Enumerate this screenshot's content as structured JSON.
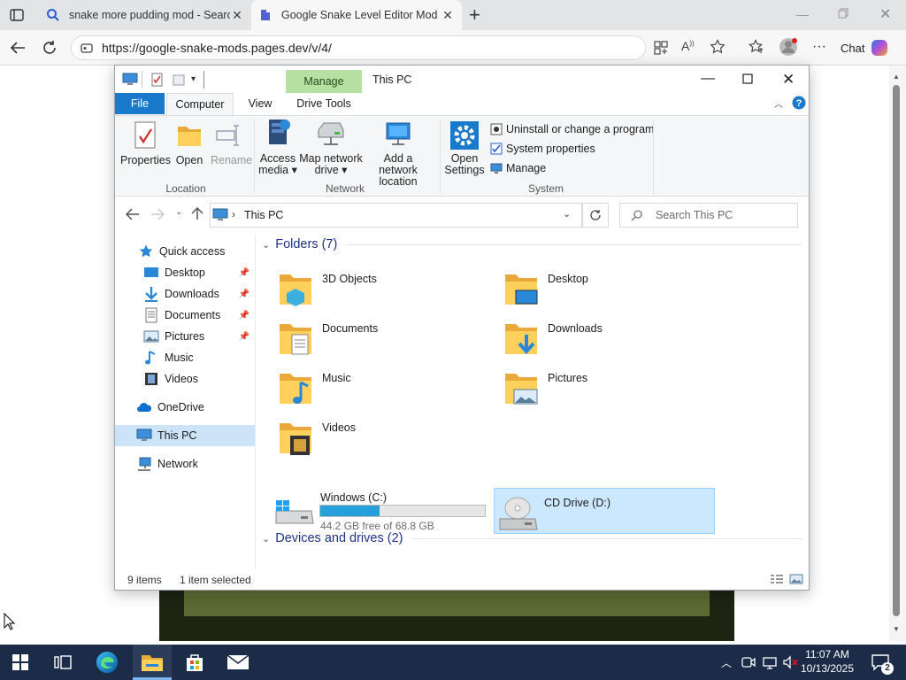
{
  "browser": {
    "tabs": [
      {
        "title": "snake more pudding mod - Search",
        "close": "✕"
      },
      {
        "title": "Google Snake Level Editor Mod",
        "close": "✕"
      }
    ],
    "new_tab": "+",
    "url": "https://google-snake-mods.pages.dev/v/4/",
    "chat_label": "Chat"
  },
  "explorer": {
    "title": "This PC",
    "contextual_tab": "Manage",
    "tabs": [
      "File",
      "Computer",
      "View",
      "Drive Tools"
    ],
    "ribbon": {
      "location": {
        "label": "Location",
        "buttons": [
          "Properties",
          "Open",
          "Rename"
        ]
      },
      "network": {
        "label": "Network",
        "buttons": [
          {
            "l1": "Access",
            "l2": "media ▾"
          },
          {
            "l1": "Map network",
            "l2": "drive ▾"
          },
          {
            "l1": "Add a network",
            "l2": "location"
          }
        ]
      },
      "system": {
        "label": "System",
        "open_settings": {
          "l1": "Open",
          "l2": "Settings"
        },
        "items": [
          "Uninstall or change a program",
          "System properties",
          "Manage"
        ]
      }
    },
    "address": {
      "path": "This PC"
    },
    "search": {
      "placeholder": "Search This PC"
    },
    "nav": {
      "quick_access": "Quick access",
      "quick_items": [
        "Desktop",
        "Downloads",
        "Documents",
        "Pictures",
        "Music",
        "Videos"
      ],
      "onedrive": "OneDrive",
      "this_pc": "This PC",
      "network": "Network"
    },
    "folders_header": "Folders (7)",
    "folders": [
      "3D Objects",
      "Desktop",
      "Documents",
      "Downloads",
      "Music",
      "Pictures",
      "Videos"
    ],
    "drives_header": "Devices and drives (2)",
    "drives": [
      {
        "name": "Windows (C:)",
        "free": "44.2 GB free of 68.8 GB",
        "used_fraction": 0.36
      },
      {
        "name": "CD Drive (D:)"
      }
    ],
    "status": {
      "items": "9 items",
      "selected": "1 item selected"
    }
  },
  "taskbar": {
    "time": "11:07 AM",
    "date": "10/13/2025",
    "notifications": "2"
  }
}
